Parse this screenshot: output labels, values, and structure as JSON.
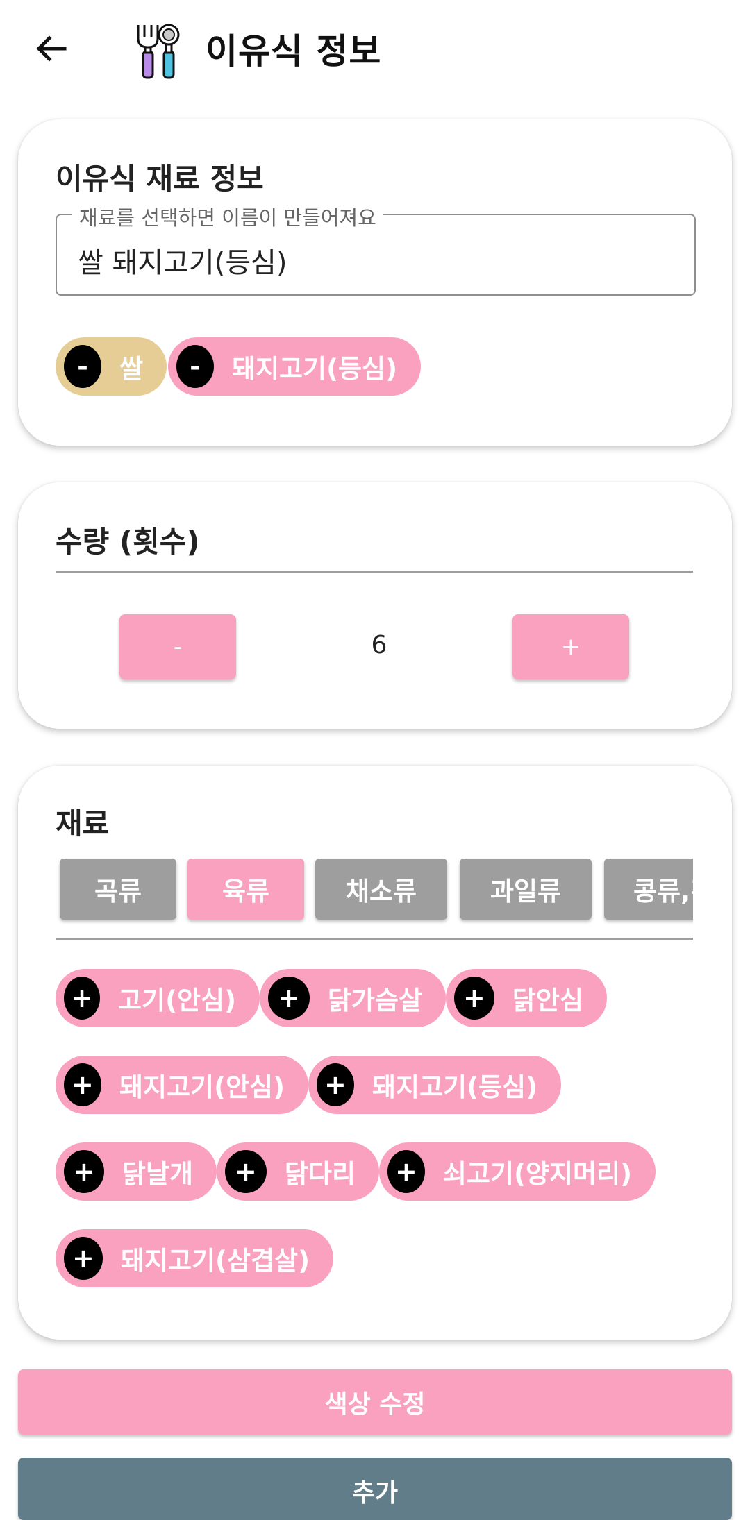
{
  "appbar": {
    "title": "이유식 정보"
  },
  "ingredient_info": {
    "title": "이유식 재료 정보",
    "name_field": {
      "label": "재료를 선택하면 이름이 만들어져요",
      "value": "쌀 돼지고기(등심)"
    },
    "selected": [
      {
        "button": "-",
        "label": "쌀",
        "color": "#e6cc95"
      },
      {
        "button": "-",
        "label": "돼지고기(등심)",
        "color": "#f9a1bf"
      }
    ]
  },
  "quantity": {
    "title": "수량 (횟수)",
    "minus_label": "-",
    "value": "6",
    "plus_label": "+"
  },
  "ingredients": {
    "title": "재료",
    "tabs": [
      "곡류",
      "육류",
      "채소류",
      "과일류",
      "콩류,견"
    ],
    "active_tab": "육류",
    "items": [
      {
        "button": "+",
        "label": "고기(안심)"
      },
      {
        "button": "+",
        "label": "닭가슴살"
      },
      {
        "button": "+",
        "label": "닭안심"
      },
      {
        "button": "+",
        "label": "돼지고기(안심)"
      },
      {
        "button": "+",
        "label": "돼지고기(등심)"
      },
      {
        "button": "+",
        "label": "닭날개"
      },
      {
        "button": "+",
        "label": "닭다리"
      },
      {
        "button": "+",
        "label": "쇠고기(양지머리)"
      },
      {
        "button": "+",
        "label": "돼지고기(삼겹살)"
      }
    ]
  },
  "actions": {
    "color_edit": "색상 수정",
    "add": "추가"
  },
  "colors": {
    "pink": "#f9a1bf",
    "rice": "#e6cc95",
    "gray": "#9e9e9e",
    "slate": "#627d8a"
  },
  "icons": {
    "back": "arrow-left-icon",
    "app": "fork-spoon-icon"
  }
}
